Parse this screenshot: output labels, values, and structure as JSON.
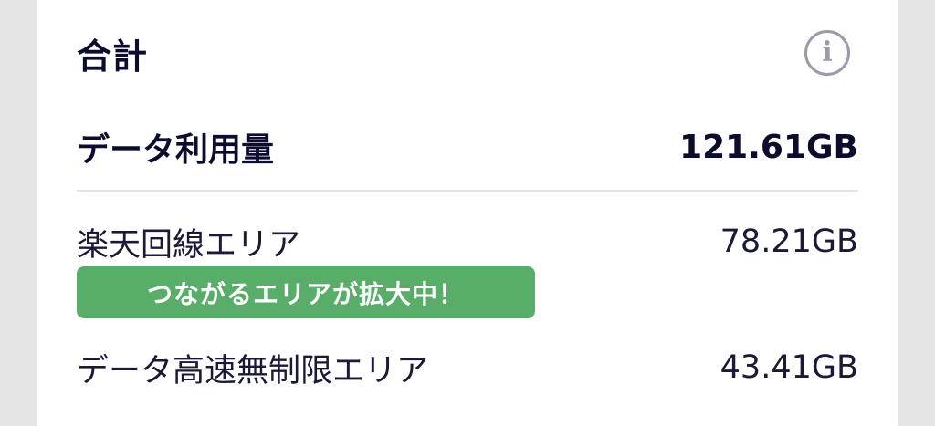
{
  "summary": {
    "title": "合計",
    "info_icon": "info-icon",
    "info_glyph": "i"
  },
  "total": {
    "label": "データ利用量",
    "value": "121.61GB"
  },
  "rakuten_area": {
    "label": "楽天回線エリア",
    "value": "78.21GB",
    "badge": "つながるエリアが拡大中！"
  },
  "unlimited_area": {
    "label": "データ高速無制限エリア",
    "value": "43.41GB"
  },
  "colors": {
    "badge_background": "#58ad69",
    "text": "#0c0c2d",
    "icon": "#9a9aa8",
    "divider": "#e2e2ea"
  }
}
